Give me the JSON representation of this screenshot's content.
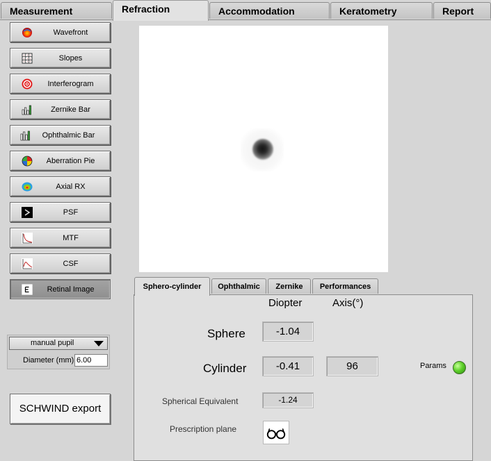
{
  "top_tabs": [
    {
      "label": "Measurement"
    },
    {
      "label": "Refraction"
    },
    {
      "label": "Accommodation"
    },
    {
      "label": "Keratometry"
    },
    {
      "label": "Report"
    }
  ],
  "active_top_tab": "Refraction",
  "sidebar": {
    "buttons": [
      {
        "label": "Wavefront",
        "icon": "wavefront-icon"
      },
      {
        "label": "Slopes",
        "icon": "slopes-grid-icon"
      },
      {
        "label": "Interferogram",
        "icon": "interferogram-icon"
      },
      {
        "label": "Zernike Bar",
        "icon": "zernike-bar-icon"
      },
      {
        "label": "Ophthalmic Bar",
        "icon": "ophthalmic-bar-icon"
      },
      {
        "label": "Aberration Pie",
        "icon": "aberration-pie-icon"
      },
      {
        "label": "Axial RX",
        "icon": "axial-rx-icon"
      },
      {
        "label": "PSF",
        "icon": "psf-icon"
      },
      {
        "label": "MTF",
        "icon": "mtf-icon"
      },
      {
        "label": "CSF",
        "icon": "csf-icon"
      },
      {
        "label": "Retinal Image",
        "icon": "retinal-image-icon"
      }
    ],
    "active": "Retinal Image"
  },
  "pupil": {
    "mode": "manual pupil",
    "diameter_label": "Diameter (mm)",
    "diameter_value": "6.00"
  },
  "export_button": "SCHWIND export",
  "sub_tabs": [
    {
      "label": "Sphero-cylinder"
    },
    {
      "label": "Ophthalmic"
    },
    {
      "label": "Zernike"
    },
    {
      "label": "Performances"
    }
  ],
  "active_sub_tab": "Sphero-cylinder",
  "refraction": {
    "diopter_header": "Diopter",
    "axis_header": "Axis(°)",
    "sphere_label": "Sphere",
    "sphere_value": "-1.04",
    "cylinder_label": "Cylinder",
    "cylinder_value": "-0.41",
    "axis_value": "96",
    "se_label": "Spherical Equivalent",
    "se_value": "-1.24",
    "plane_label": "Prescription plane",
    "plane_icon": "spectacles-icon",
    "params_label": "Params",
    "params_status_color": "#5fd12b"
  }
}
